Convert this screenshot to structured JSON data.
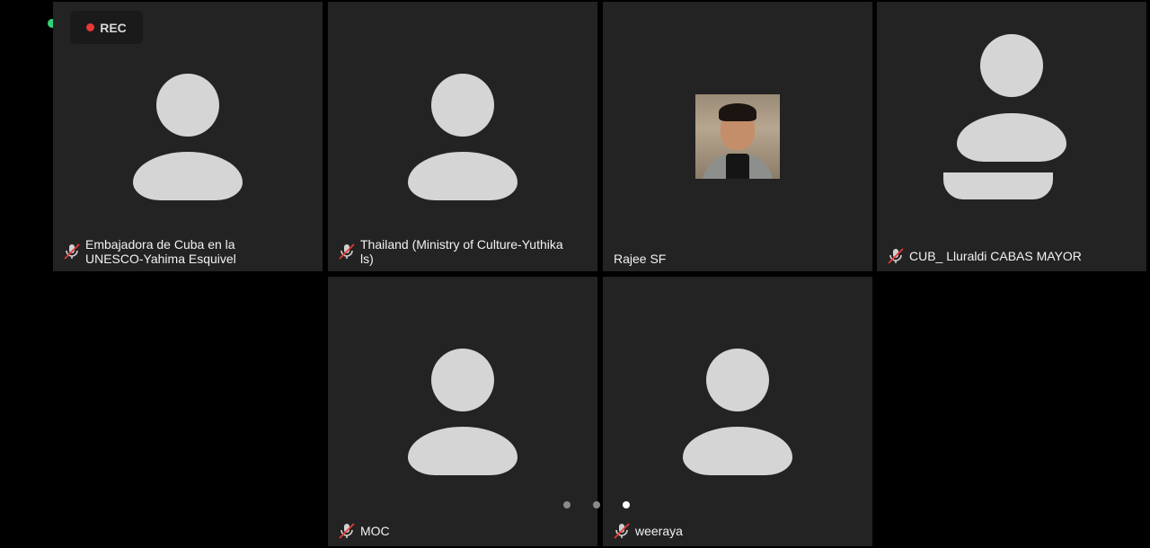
{
  "recording": {
    "label": "REC",
    "dot_color": "#e53935"
  },
  "status_indicator": {
    "color": "#33d17a"
  },
  "participants": [
    {
      "name": "Embajadora de Cuba en la\nUNESCO-Yahima Esquivel",
      "muted": true,
      "video": "avatar"
    },
    {
      "name": "Thailand (Ministry of Culture-Yuthika\nls)",
      "muted": true,
      "video": "avatar"
    },
    {
      "name": "Rajee SF",
      "muted": false,
      "video": "photo"
    },
    {
      "name": "CUB_ Lluraldi CABAS MAYOR",
      "muted": true,
      "video": "avatar"
    },
    {
      "name": "MOC",
      "muted": true,
      "video": "avatar"
    },
    {
      "name": "weeraya",
      "muted": true,
      "video": "avatar"
    }
  ],
  "pagination": {
    "pages": 3,
    "current": 3
  },
  "icons": {
    "mic_muted": "mic-off-icon",
    "avatar": "person-icon"
  }
}
